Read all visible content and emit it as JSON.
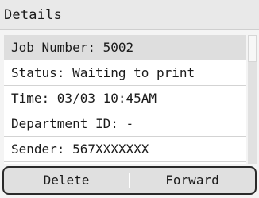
{
  "header": {
    "title": "Details"
  },
  "details": {
    "items": [
      {
        "label": "Job Number: 5002"
      },
      {
        "label": "Status: Waiting to print"
      },
      {
        "label": "Time: 03/03 10:45AM"
      },
      {
        "label": "Department ID: -"
      },
      {
        "label": "Sender: 567XXXXXXX"
      }
    ]
  },
  "footer": {
    "left_label": "Delete",
    "right_label": "Forward"
  }
}
